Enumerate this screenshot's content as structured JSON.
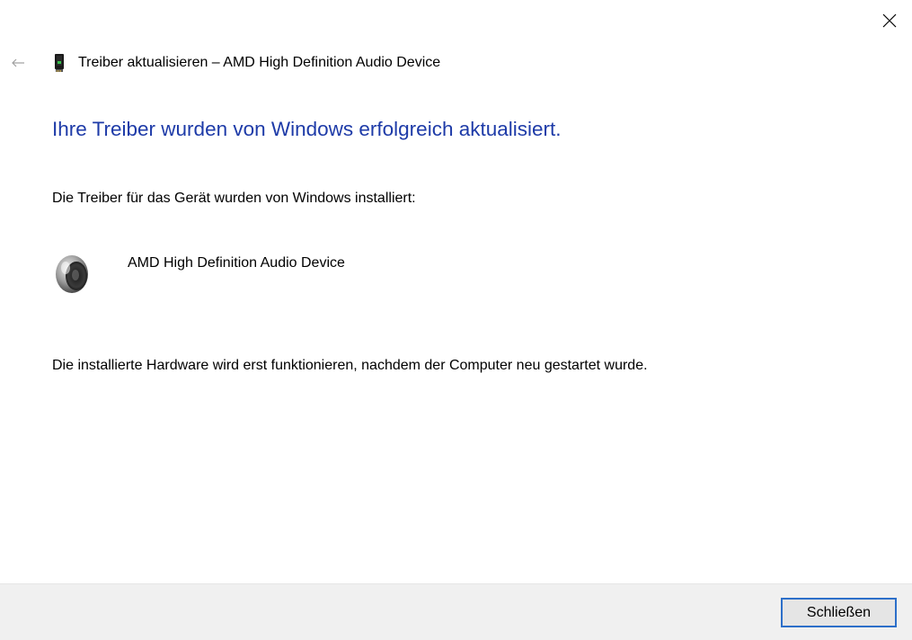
{
  "window": {
    "title": "Treiber aktualisieren – AMD High Definition Audio Device"
  },
  "icons": {
    "close": "close-icon",
    "back": "back-arrow-icon",
    "device": "device-card-icon",
    "speaker": "speaker-icon"
  },
  "content": {
    "heading": "Ihre Treiber wurden von Windows erfolgreich aktualisiert.",
    "intro": "Die Treiber für das Gerät wurden von Windows installiert:",
    "device_name": "AMD High Definition Audio Device",
    "restart_note": "Die installierte Hardware wird erst funktionieren, nachdem der Computer neu gestartet wurde."
  },
  "footer": {
    "close_label": "Schließen"
  },
  "colors": {
    "heading": "#1e3ba8",
    "button_border": "#2c6fc9",
    "footer_bg": "#f0f0f0"
  }
}
